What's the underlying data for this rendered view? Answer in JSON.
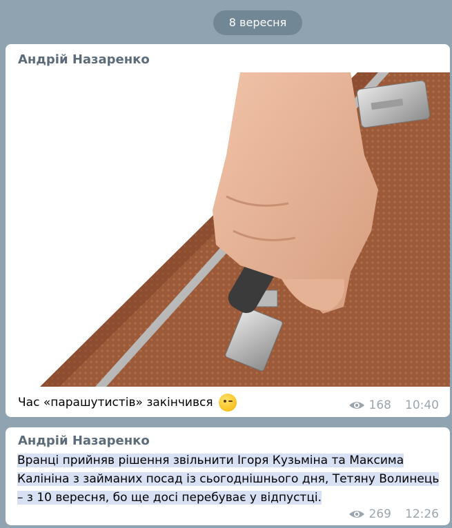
{
  "date_separator": "8 вересня",
  "messages": [
    {
      "author": "Андрій Назаренко",
      "caption": "Час «парашутистів» закінчився",
      "emoji": "winking-face",
      "views": "168",
      "time": "10:40"
    },
    {
      "author": "Андрій Назаренко",
      "text": "Вранці прийняв рішення звільнити Ігоря Кузьміна та Максима Калініна з займаних посад із сьогоднішнього дня, Тетяну Волинець – з 10 вересня, бо ще досі перебуває у відпустці.",
      "views": "269",
      "time": "12:26"
    }
  ],
  "colors": {
    "background": "#8fa3b1",
    "bubble": "#ffffff",
    "author": "#5b6b79",
    "meta": "#9aa5ad",
    "selection": "#d7e1f3"
  }
}
